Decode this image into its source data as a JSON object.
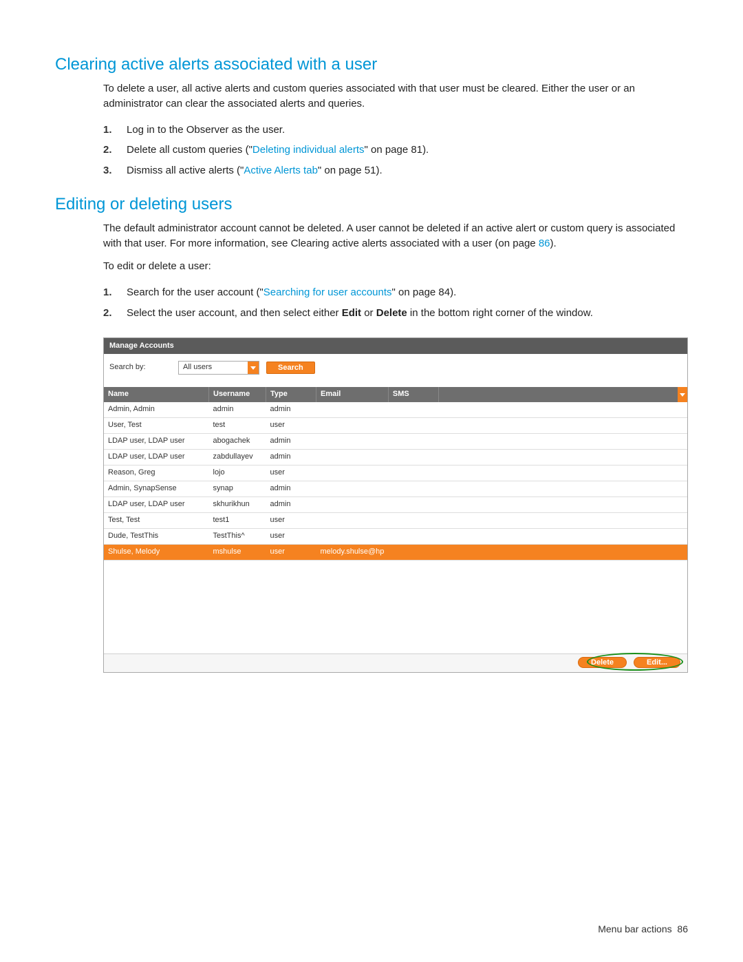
{
  "section1": {
    "title": "Clearing active alerts associated with a user",
    "intro": "To delete a user, all active alerts and custom queries associated with that user must be cleared. Either the user or an administrator can clear the associated alerts and queries.",
    "steps": [
      {
        "num": "1.",
        "pre": "Log in to the Observer as the user.",
        "link": "",
        "post": ""
      },
      {
        "num": "2.",
        "pre": "Delete all custom queries (\"",
        "link": "Deleting individual alerts",
        "post": "\" on page 81)."
      },
      {
        "num": "3.",
        "pre": "Dismiss all active alerts (\"",
        "link": "Active Alerts tab",
        "post": "\" on page 51)."
      }
    ]
  },
  "section2": {
    "title": "Editing or deleting users",
    "intro_pre": "The default administrator account cannot be deleted. A user cannot be deleted if an active alert or custom query is associated with that user. For more information, see Clearing active alerts associated with a user (on page ",
    "intro_link": "86",
    "intro_post": ").",
    "lead": "To edit or delete a user:",
    "steps": [
      {
        "num": "1.",
        "pre": "Search for the user account (\"",
        "link": "Searching for user accounts",
        "post": "\" on page 84)."
      },
      {
        "num": "2.",
        "pre": "Select the user account, and then select either ",
        "b1": "Edit",
        "mid": " or ",
        "b2": "Delete",
        "post": " in the bottom right corner of the window."
      }
    ]
  },
  "panel": {
    "title": "Manage Accounts",
    "search_label": "Search by:",
    "dropdown_value": "All users",
    "search_button": "Search",
    "columns": [
      "Name",
      "Username",
      "Type",
      "Email",
      "SMS",
      ""
    ],
    "rows": [
      {
        "name": "Admin, Admin",
        "username": "admin",
        "type": "admin",
        "email": "",
        "sms": "",
        "selected": false
      },
      {
        "name": "User, Test",
        "username": "test",
        "type": "user",
        "email": "",
        "sms": "",
        "selected": false
      },
      {
        "name": "LDAP user, LDAP user",
        "username": "abogachek",
        "type": "admin",
        "email": "",
        "sms": "",
        "selected": false
      },
      {
        "name": "LDAP user, LDAP user",
        "username": "zabdullayev",
        "type": "admin",
        "email": "",
        "sms": "",
        "selected": false
      },
      {
        "name": "Reason, Greg",
        "username": "lojo",
        "type": "user",
        "email": "",
        "sms": "",
        "selected": false
      },
      {
        "name": "Admin, SynapSense",
        "username": "synap",
        "type": "admin",
        "email": "",
        "sms": "",
        "selected": false
      },
      {
        "name": "LDAP user, LDAP user",
        "username": "skhurikhun",
        "type": "admin",
        "email": "",
        "sms": "",
        "selected": false
      },
      {
        "name": "Test, Test",
        "username": "test1",
        "type": "user",
        "email": "",
        "sms": "",
        "selected": false
      },
      {
        "name": "Dude, TestThis",
        "username": "TestThis^",
        "type": "user",
        "email": "",
        "sms": "",
        "selected": false
      },
      {
        "name": "Shulse, Melody",
        "username": "mshulse",
        "type": "user",
        "email": "melody.shulse@hp",
        "sms": "",
        "selected": true
      }
    ],
    "delete_button": "Delete",
    "edit_button": "Edit..."
  },
  "footer": {
    "label": "Menu bar actions",
    "page": "86"
  }
}
